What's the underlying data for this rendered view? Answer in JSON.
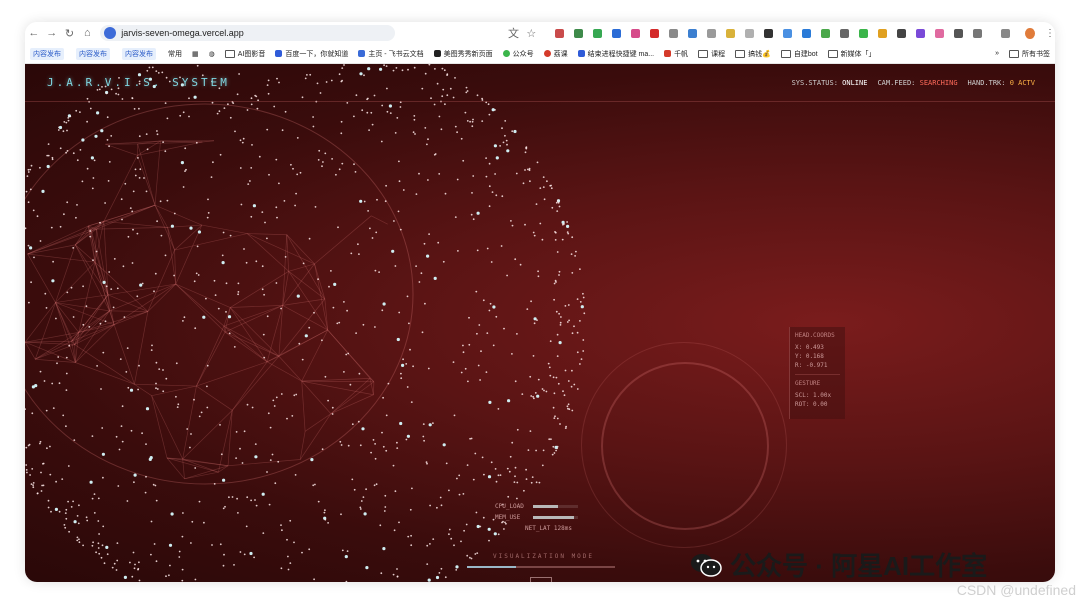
{
  "browser": {
    "url": "jarvis-seven-omega.vercel.app",
    "bookmarks": [
      {
        "tag": "内容发布"
      },
      {
        "tag": "内容发布"
      },
      {
        "tag": "内容发布"
      },
      {
        "label": "常用"
      },
      {
        "label": "AI图影音"
      },
      {
        "label": "百度一下，你就知道"
      },
      {
        "label": "主页 - 飞书云文档"
      },
      {
        "label": "美图秀秀新页面"
      },
      {
        "label": "公众号"
      },
      {
        "label": "荔课"
      },
      {
        "label": "结束进程快捷键 ma..."
      },
      {
        "label": "千帆"
      },
      {
        "label": "课程"
      },
      {
        "label": "搞钱💰"
      },
      {
        "label": "自建bot"
      },
      {
        "label": "新媒体「」"
      }
    ],
    "more": "»",
    "all_bookmarks": "所有书签"
  },
  "hud": {
    "brand": "J.A.R.V.I.S. SYSTEM",
    "status": {
      "sys_label": "SYS.STATUS:",
      "sys_value": "ONLINE",
      "cam_label": "CAM.FEED:",
      "cam_value": "SEARCHING",
      "hand_label": "HAND.TRK:",
      "hand_value": "0 ACTV"
    },
    "coords": {
      "header": "HEAD.COORDS",
      "x": "X: 0.493",
      "y": "Y: 0.168",
      "r": "R: -0.971",
      "gesture_header": "GESTURE",
      "scl": "SCL: 1.00x",
      "rot": "ROT: 0.00"
    },
    "metrics": {
      "cpu_label": "CPU_LOAD",
      "cpu_value": 0.55,
      "mem_label": "MEM_USE",
      "mem_value": 0.9,
      "net": "NET_LAT 128ms"
    },
    "mode": "VISUALIZATION MODE",
    "mode_progress": 0.33
  },
  "watermark": {
    "text": "公众号 · 阿星AI工作室",
    "csdn": "CSDN @undefined"
  },
  "colors": {
    "accent_cyan": "#7fd6e0",
    "searching": "#ff6a5a",
    "actv": "#ffb347",
    "background": "#5a1414"
  }
}
